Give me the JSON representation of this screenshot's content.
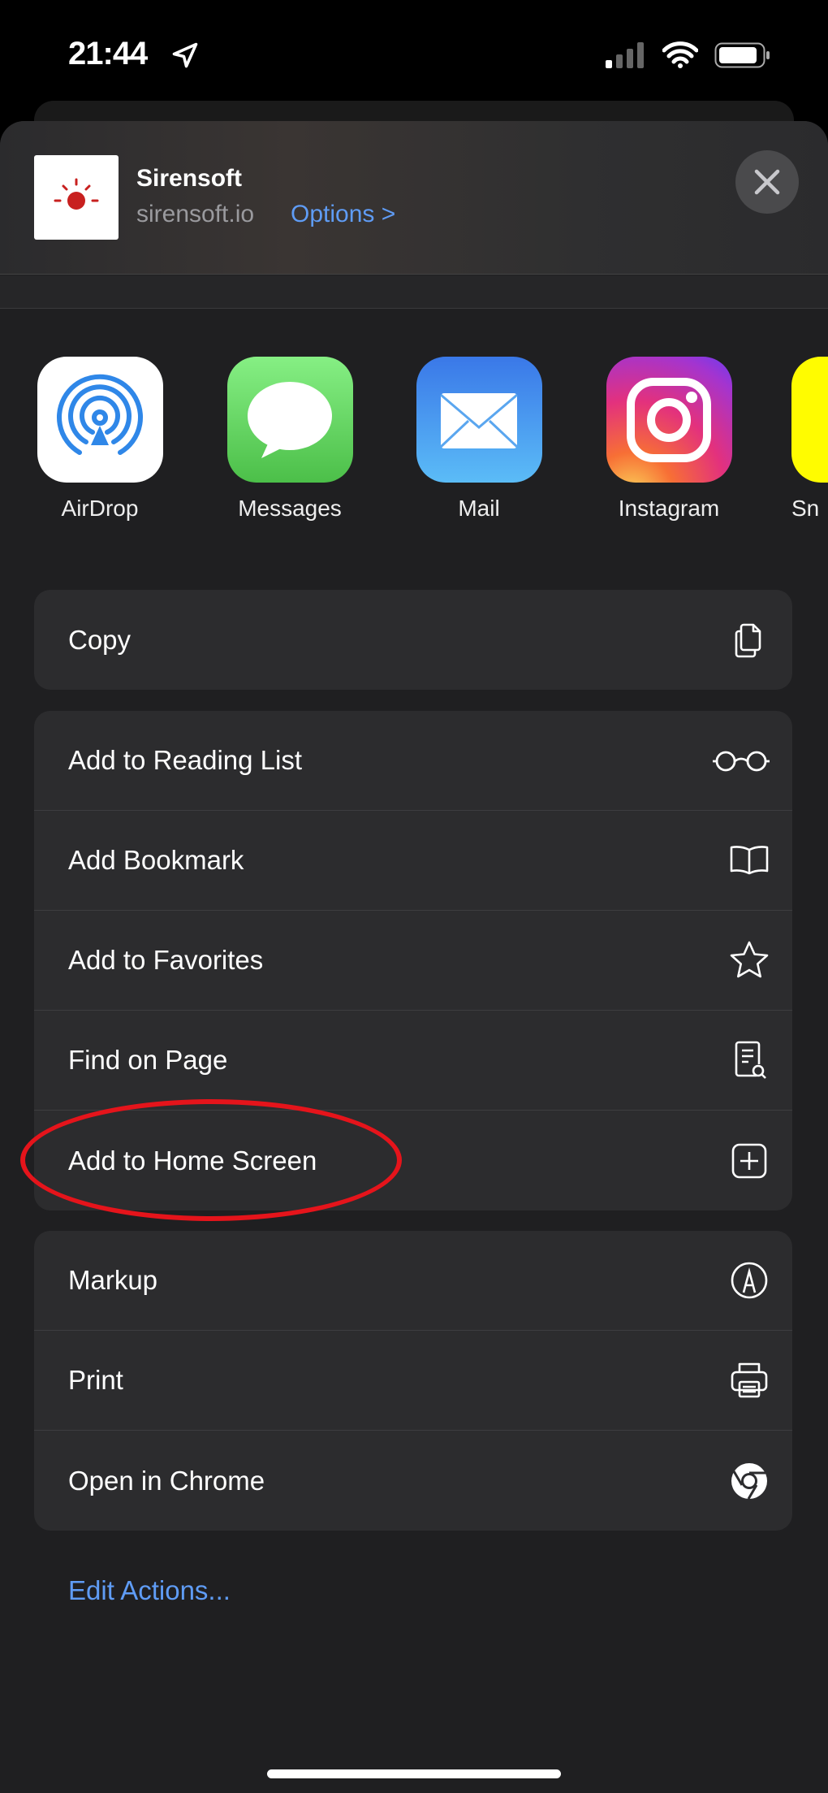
{
  "status_bar": {
    "time": "21:44"
  },
  "header": {
    "title": "Sirensoft",
    "domain": "sirensoft.io",
    "options_label": "Options",
    "options_chevron": ">"
  },
  "apps": [
    {
      "label": "AirDrop",
      "icon": "airdrop-icon"
    },
    {
      "label": "Messages",
      "icon": "messages-icon"
    },
    {
      "label": "Mail",
      "icon": "mail-icon"
    },
    {
      "label": "Instagram",
      "icon": "instagram-icon"
    },
    {
      "label": "Sn",
      "icon": "snapchat-icon"
    }
  ],
  "groups": [
    [
      {
        "label": "Copy",
        "icon": "copy-icon"
      }
    ],
    [
      {
        "label": "Add to Reading List",
        "icon": "glasses-icon"
      },
      {
        "label": "Add Bookmark",
        "icon": "book-icon"
      },
      {
        "label": "Add to Favorites",
        "icon": "star-icon"
      },
      {
        "label": "Find on Page",
        "icon": "find-doc-icon"
      },
      {
        "label": "Add to Home Screen",
        "icon": "plus-square-icon"
      }
    ],
    [
      {
        "label": "Markup",
        "icon": "markup-icon"
      },
      {
        "label": "Print",
        "icon": "printer-icon"
      },
      {
        "label": "Open in Chrome",
        "icon": "chrome-icon"
      }
    ]
  ],
  "edit_actions": "Edit Actions...",
  "colors": {
    "accent": "#5f9cf5",
    "highlight": "#e5141b",
    "background": "#1f1f21",
    "group": "#2c2c2e"
  }
}
